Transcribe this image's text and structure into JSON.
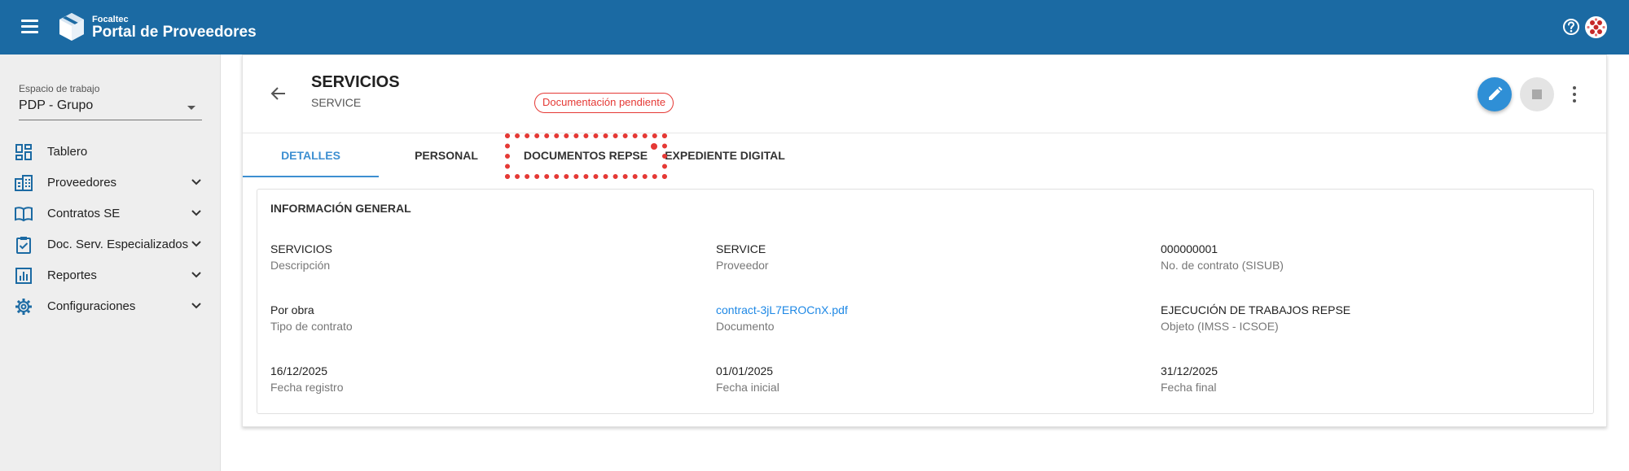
{
  "topbar": {
    "brand_small": "Focaltec",
    "brand_title": "Portal de Proveedores",
    "icons": [
      "menu-icon",
      "logo-icon",
      "help-icon",
      "avatar"
    ]
  },
  "sidebar": {
    "workspace_label": "Espacio de trabajo",
    "workspace_value": "PDP - Grupo",
    "items": [
      {
        "label": "Tablero",
        "icon": "dashboard-icon",
        "expandable": false
      },
      {
        "label": "Proveedores",
        "icon": "building-icon",
        "expandable": true
      },
      {
        "label": "Contratos SE",
        "icon": "book-icon",
        "expandable": true
      },
      {
        "label": "Doc. Serv. Especializados",
        "icon": "clipboard-check-icon",
        "expandable": true
      },
      {
        "label": "Reportes",
        "icon": "bar-chart-icon",
        "expandable": true
      },
      {
        "label": "Configuraciones",
        "icon": "gear-icon",
        "expandable": true
      }
    ]
  },
  "header": {
    "title": "SERVICIOS",
    "subtitle": "SERVICE",
    "status_badge": "Documentación pendiente"
  },
  "tabs": [
    {
      "label": "DETALLES",
      "active": true
    },
    {
      "label": "PERSONAL",
      "active": false
    },
    {
      "label": "DOCUMENTOS REPSE",
      "active": false
    },
    {
      "label": "EXPEDIENTE DIGITAL",
      "active": false
    }
  ],
  "info": {
    "section_title": "INFORMACIÓN GENERAL",
    "fields": [
      {
        "value": "SERVICIOS",
        "label": "Descripción",
        "link": false
      },
      {
        "value": "SERVICE",
        "label": "Proveedor",
        "link": false
      },
      {
        "value": "000000001",
        "label": "No. de contrato (SISUB)",
        "link": false
      },
      {
        "value": "Por obra",
        "label": "Tipo de contrato",
        "link": false
      },
      {
        "value": "contract-3jL7EROCnX.pdf",
        "label": "Documento",
        "link": true
      },
      {
        "value": "EJECUCIÓN DE TRABAJOS REPSE",
        "label": "Objeto (IMSS - ICSOE)",
        "link": false
      },
      {
        "value": "16/12/2025",
        "label": "Fecha registro",
        "link": false
      },
      {
        "value": "01/01/2025",
        "label": "Fecha inicial",
        "link": false
      },
      {
        "value": "31/12/2025",
        "label": "Fecha final",
        "link": false
      }
    ]
  },
  "colors": {
    "topbar": "#1b6aa3",
    "accent": "#3d8fd1",
    "badge": "#e53935",
    "link": "#1e88e5",
    "sidebar_icon": "#1b6aa3"
  }
}
